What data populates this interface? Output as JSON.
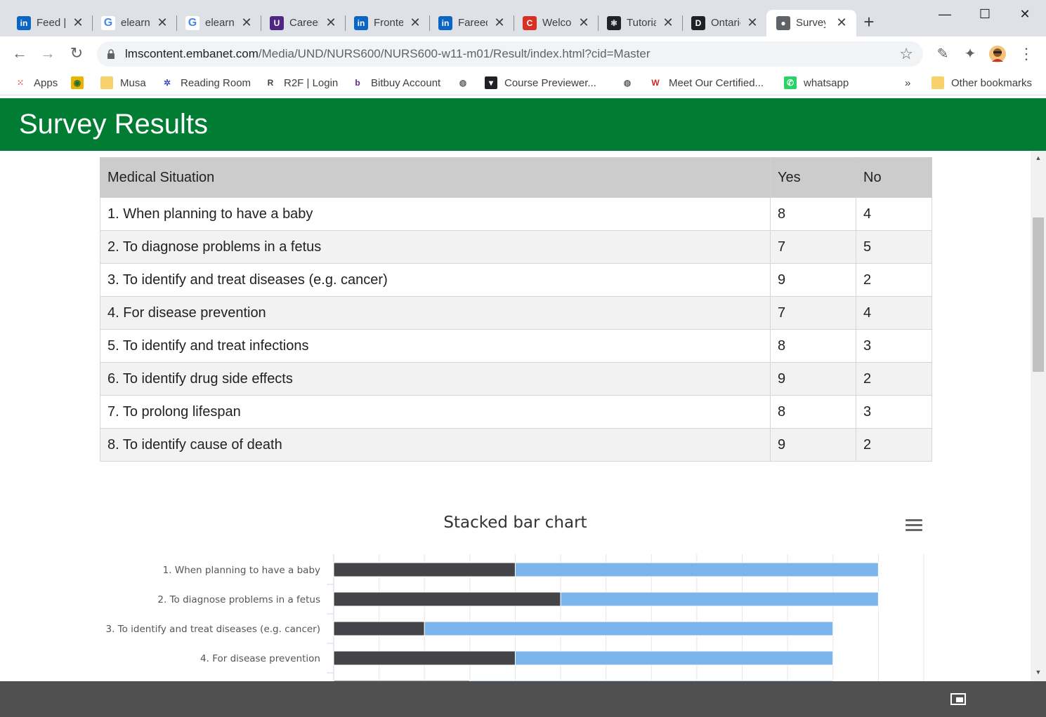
{
  "browser": {
    "tabs": [
      {
        "title": "Feed | LinkedIn",
        "icon": "linkedin-icon"
      },
      {
        "title": "elearning - Google",
        "icon": "google-icon"
      },
      {
        "title": "elearning - Google",
        "icon": "google-icon"
      },
      {
        "title": "Careers",
        "icon": "university-icon"
      },
      {
        "title": "Frontend",
        "icon": "linkedin-icon"
      },
      {
        "title": "Fareed",
        "icon": "linkedin-icon"
      },
      {
        "title": "Welcome",
        "icon": "c-icon"
      },
      {
        "title": "Tutorial",
        "icon": "react-icon"
      },
      {
        "title": "Ontario",
        "icon": "dms-icon"
      },
      {
        "title": "Survey Results",
        "icon": "globe-icon"
      }
    ],
    "url_host": "lmscontent.embanet.com",
    "url_path": "/Media/UND/NURS600/NURS600-w11-m01/Result/index.html?cid=Master",
    "bookmarks": [
      {
        "label": "Apps",
        "icon": "apps-grid-icon"
      },
      {
        "label": "",
        "icon": "folder-image-icon"
      },
      {
        "label": "Musa",
        "icon": "folder-icon"
      },
      {
        "label": "Reading Room",
        "icon": "reading-room-icon"
      },
      {
        "label": "R2F | Login",
        "icon": "r2f-icon"
      },
      {
        "label": "Bitbuy Account",
        "icon": "bitbuy-icon"
      },
      {
        "label": "",
        "icon": "globe-icon"
      },
      {
        "label": "Course Previewer...",
        "icon": "course-previewer-icon"
      },
      {
        "label": "",
        "icon": "globe-icon"
      },
      {
        "label": "Meet Our Certified...",
        "icon": "certified-icon"
      },
      {
        "label": "whatsapp",
        "icon": "whatsapp-icon"
      }
    ],
    "overflow": "»",
    "other_bookmarks": "Other bookmarks"
  },
  "page": {
    "title": "Survey Results",
    "table": {
      "headers": [
        "Medical Situation",
        "Yes",
        "No"
      ],
      "rows": [
        [
          "1. When planning to have a baby",
          "8",
          "4"
        ],
        [
          "2. To diagnose problems in a fetus",
          "7",
          "5"
        ],
        [
          "3. To identify and treat diseases (e.g. cancer)",
          "9",
          "2"
        ],
        [
          "4. For disease prevention",
          "7",
          "4"
        ],
        [
          "5. To identify and treat infections",
          "8",
          "3"
        ],
        [
          "6. To identify drug side effects",
          "9",
          "2"
        ],
        [
          "7. To prolong lifespan",
          "8",
          "3"
        ],
        [
          "8. To identify cause of death",
          "9",
          "2"
        ]
      ]
    }
  },
  "chart_data": {
    "type": "bar",
    "orientation": "horizontal",
    "stacked": true,
    "title": "Stacked bar chart",
    "categories": [
      "1. When planning to have a baby",
      "2. To diagnose problems in a fetus",
      "3. To identify and treat diseases (e.g. cancer)",
      "4. For disease prevention",
      "5. To identify and treat infections"
    ],
    "series": [
      {
        "values": [
          4,
          5,
          2,
          4,
          3
        ],
        "color": "#434348"
      },
      {
        "values": [
          8,
          7,
          9,
          7,
          8
        ],
        "color": "#7cb5ec"
      }
    ],
    "xlim": [
      0,
      13
    ],
    "grid": true,
    "x_tick_labels_visible": false
  }
}
